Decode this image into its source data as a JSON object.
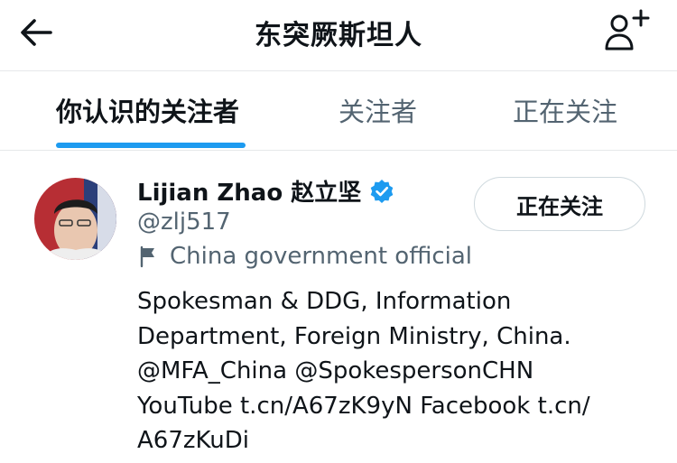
{
  "header": {
    "title": "东突厥斯坦人",
    "back_icon": "arrow-left-icon",
    "follow_icon": "person-add-icon"
  },
  "tabs": [
    {
      "label": "你认识的关注者",
      "active": true
    },
    {
      "label": "关注者",
      "active": false
    },
    {
      "label": "正在关注",
      "active": false
    }
  ],
  "user": {
    "display_name": "Lijian Zhao 赵立坚",
    "verified": true,
    "handle": "@zlj517",
    "label": "China government official",
    "bio_lines": [
      "Spokesman & DDG, Information",
      "Department, Foreign Ministry, China.",
      "@MFA_China @SpokespersonCHN",
      "YouTube t.cn/A67zK9yN Facebook t.cn/",
      "A67zKuDi"
    ],
    "follow_button_label": "正在关注"
  },
  "colors": {
    "accent": "#1d9bf0",
    "text_primary": "#0f1419",
    "text_secondary": "#536471",
    "divider": "#e6e8ea"
  }
}
